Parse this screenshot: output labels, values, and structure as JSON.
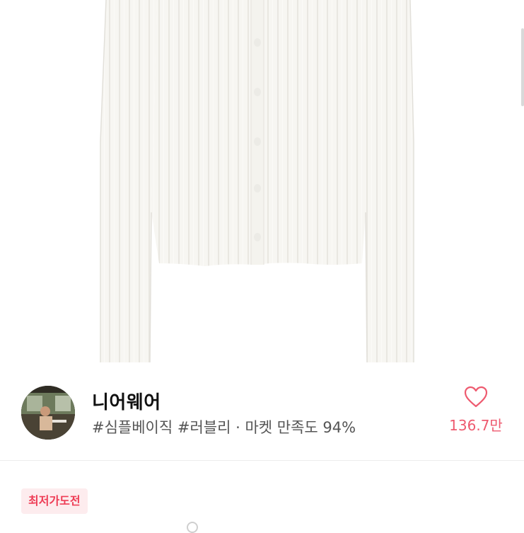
{
  "product": {
    "image_alt": "white ribbed button cardigan"
  },
  "shop": {
    "name": "니어웨어",
    "tags": "#심플베이직 #러블리 · 마켓 만족도 94%",
    "avatar_icon": "shop-avatar-photo"
  },
  "wish": {
    "icon": "heart-outline-icon",
    "count": "136.7만",
    "color": "#ee5a6f"
  },
  "badge": {
    "label": "최저가도전",
    "color": "#ee3d56",
    "background": "#fdecee"
  }
}
